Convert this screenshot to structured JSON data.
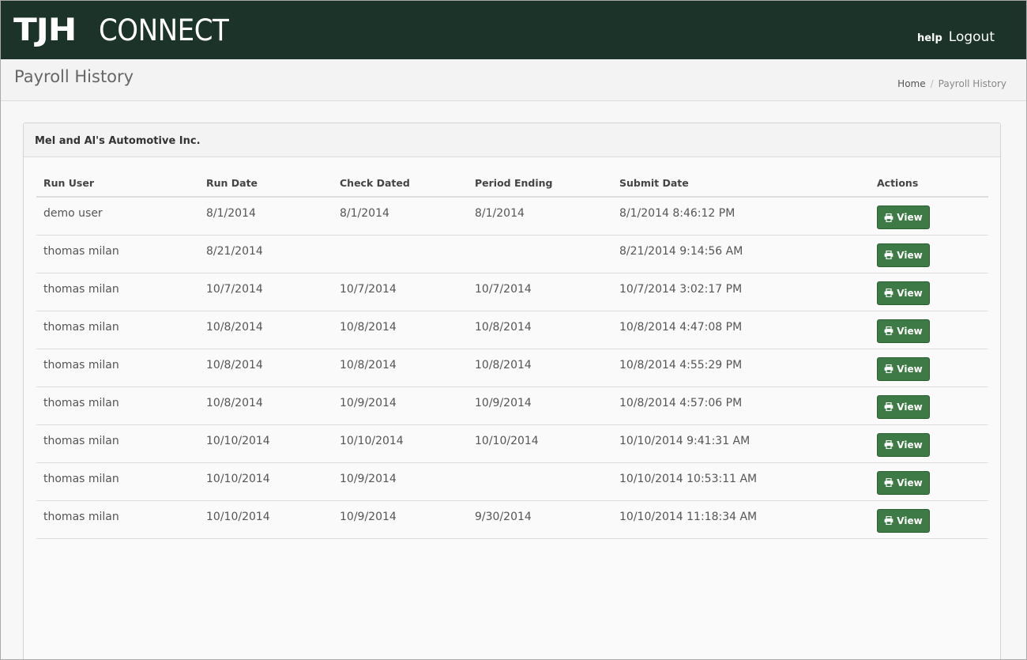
{
  "brand": {
    "logo_bold": "TJH",
    "logo_light": "CONNECT"
  },
  "topnav": {
    "help_label": "help",
    "logout_label": "Logout"
  },
  "header": {
    "page_title": "Payroll History",
    "breadcrumb": {
      "home": "Home",
      "separator": "/",
      "current": "Payroll History"
    }
  },
  "panel": {
    "title": "Mel and Al's Automotive Inc."
  },
  "table": {
    "columns": [
      "Run User",
      "Run Date",
      "Check Dated",
      "Period Ending",
      "Submit Date",
      "Actions"
    ],
    "view_label": "View",
    "rows": [
      {
        "run_user": "demo user",
        "run_date": "8/1/2014",
        "check_dated": "8/1/2014",
        "period_ending": "8/1/2014",
        "submit_date": "8/1/2014 8:46:12 PM"
      },
      {
        "run_user": "thomas milan",
        "run_date": "8/21/2014",
        "check_dated": "",
        "period_ending": "",
        "submit_date": "8/21/2014 9:14:56 AM"
      },
      {
        "run_user": "thomas milan",
        "run_date": "10/7/2014",
        "check_dated": "10/7/2014",
        "period_ending": "10/7/2014",
        "submit_date": "10/7/2014 3:02:17 PM"
      },
      {
        "run_user": "thomas milan",
        "run_date": "10/8/2014",
        "check_dated": "10/8/2014",
        "period_ending": "10/8/2014",
        "submit_date": "10/8/2014 4:47:08 PM"
      },
      {
        "run_user": "thomas milan",
        "run_date": "10/8/2014",
        "check_dated": "10/8/2014",
        "period_ending": "10/8/2014",
        "submit_date": "10/8/2014 4:55:29 PM"
      },
      {
        "run_user": "thomas milan",
        "run_date": "10/8/2014",
        "check_dated": "10/9/2014",
        "period_ending": "10/9/2014",
        "submit_date": "10/8/2014 4:57:06 PM"
      },
      {
        "run_user": "thomas milan",
        "run_date": "10/10/2014",
        "check_dated": "10/10/2014",
        "period_ending": "10/10/2014",
        "submit_date": "10/10/2014 9:41:31 AM"
      },
      {
        "run_user": "thomas milan",
        "run_date": "10/10/2014",
        "check_dated": "10/9/2014",
        "period_ending": "",
        "submit_date": "10/10/2014 10:53:11 AM"
      },
      {
        "run_user": "thomas milan",
        "run_date": "10/10/2014",
        "check_dated": "10/9/2014",
        "period_ending": "9/30/2014",
        "submit_date": "10/10/2014 11:18:34 AM"
      }
    ]
  },
  "colors": {
    "topbar": "#1b3329",
    "button": "#3d7a46"
  },
  "icons": {
    "view_button_icon": "print-icon"
  }
}
